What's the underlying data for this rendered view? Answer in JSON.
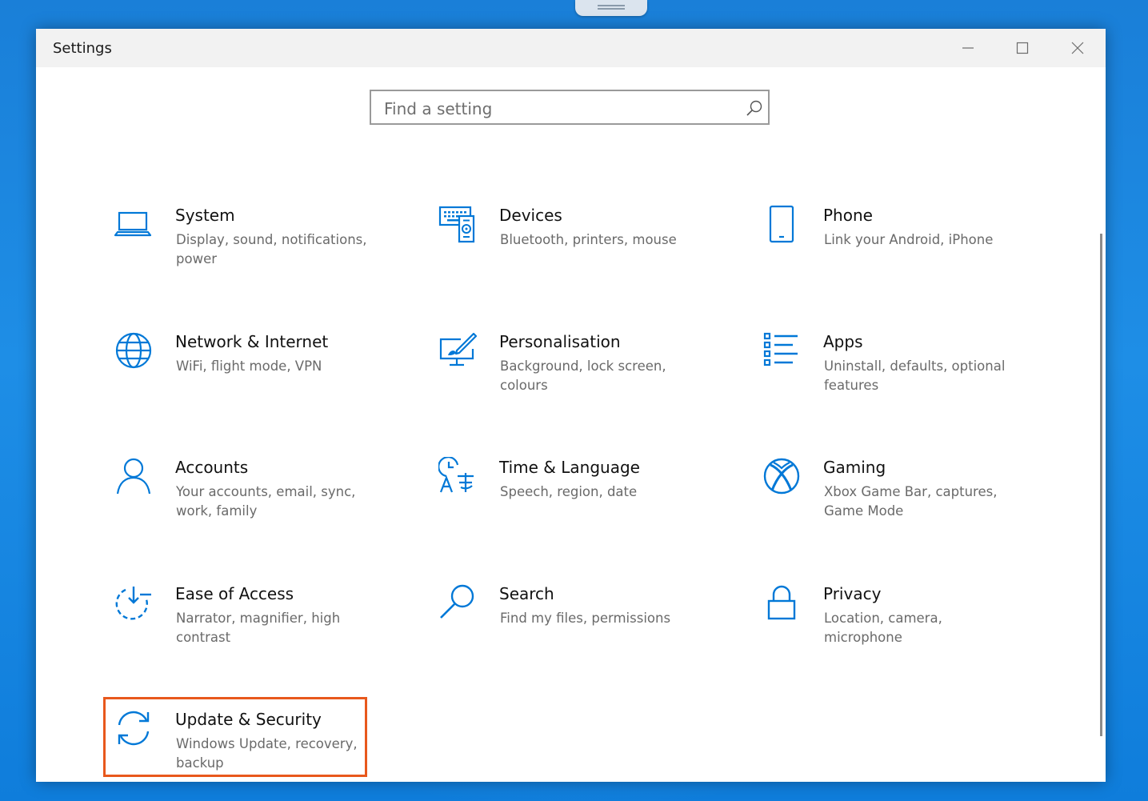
{
  "window": {
    "title": "Settings",
    "controls": {
      "minimize": "—",
      "maximize": "☐",
      "close": "✕"
    }
  },
  "search": {
    "placeholder": "Find a setting",
    "value": ""
  },
  "categories": [
    {
      "name": "System",
      "description": "Display, sound, notifications, power",
      "icon": "laptop-icon"
    },
    {
      "name": "Devices",
      "description": "Bluetooth, printers, mouse",
      "icon": "devices-icon"
    },
    {
      "name": "Phone",
      "description": "Link your Android, iPhone",
      "icon": "phone-icon"
    },
    {
      "name": "Network & Internet",
      "description": "WiFi, flight mode, VPN",
      "icon": "globe-icon"
    },
    {
      "name": "Personalisation",
      "description": "Background, lock screen, colours",
      "icon": "personalisation-icon"
    },
    {
      "name": "Apps",
      "description": "Uninstall, defaults, optional features",
      "icon": "apps-list-icon"
    },
    {
      "name": "Accounts",
      "description": "Your accounts, email, sync, work, family",
      "icon": "person-icon"
    },
    {
      "name": "Time & Language",
      "description": "Speech, region, date",
      "icon": "time-language-icon"
    },
    {
      "name": "Gaming",
      "description": "Xbox Game Bar, captures, Game Mode",
      "icon": "xbox-icon"
    },
    {
      "name": "Ease of Access",
      "description": "Narrator, magnifier, high contrast",
      "icon": "ease-of-access-icon"
    },
    {
      "name": "Search",
      "description": "Find my files, permissions",
      "icon": "magnifier-icon"
    },
    {
      "name": "Privacy",
      "description": "Location, camera, microphone",
      "icon": "lock-icon"
    },
    {
      "name": "Update & Security",
      "description": "Windows Update, recovery, backup",
      "icon": "sync-icon",
      "highlighted": true
    }
  ],
  "colors": {
    "accent": "#0078d7",
    "highlight_border": "#e8581c"
  }
}
